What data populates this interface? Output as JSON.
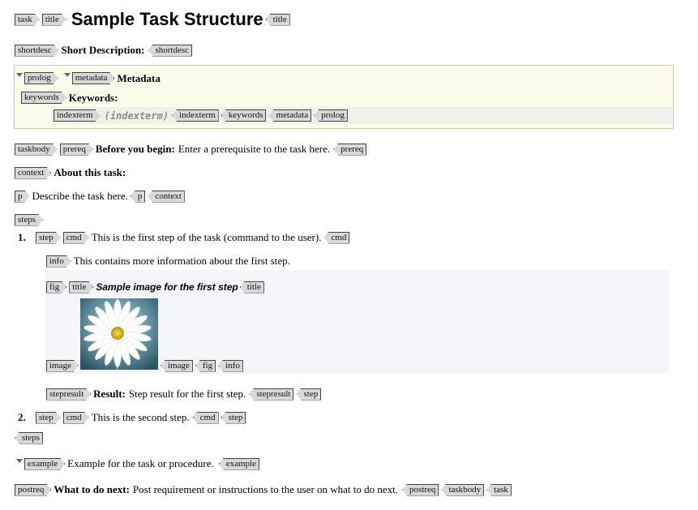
{
  "header": {
    "tag_task": "task",
    "tag_title": "title",
    "title": "Sample Task Structure"
  },
  "shortdesc": {
    "tag": "shortdesc",
    "label": "Short Description:"
  },
  "prolog": {
    "tag_prolog": "prolog",
    "tag_metadata": "metadata",
    "metadata_label": "Metadata",
    "tag_keywords": "keywords",
    "keywords_label": "Keywords:",
    "tag_indexterm": "indexterm",
    "indexterm_placeholder": "(indexterm)"
  },
  "taskbody": {
    "tag": "taskbody"
  },
  "prereq": {
    "tag": "prereq",
    "label": "Before you begin:",
    "text": "Enter a prerequisite to the task here."
  },
  "context": {
    "tag": "context",
    "label": "About this task:",
    "tag_p": "p",
    "p_text": "Describe the task here."
  },
  "steps": {
    "tag": "steps",
    "step1": {
      "number": "1.",
      "tag_step": "step",
      "tag_cmd": "cmd",
      "cmd_text": "This is the first step of the task (command to the user).",
      "tag_info": "info",
      "info_text": "This contains more information about the first step.",
      "tag_fig": "fig",
      "tag_title": "title",
      "fig_title": "Sample image for the first step",
      "tag_image": "image",
      "tag_stepresult": "stepresult",
      "result_label": "Result:",
      "result_text": "Step result for the first step."
    },
    "step2": {
      "number": "2.",
      "tag_step": "step",
      "tag_cmd": "cmd",
      "cmd_text": "This is the second step."
    }
  },
  "example": {
    "tag": "example",
    "text": "Example for the task or procedure."
  },
  "postreq": {
    "tag": "postreq",
    "label": "What to do next:",
    "text": "Post requirement or instructions to the user on what to do next."
  },
  "icons": {
    "collapse": "collapse-triangle-icon",
    "image": "daisy-flower-image"
  }
}
